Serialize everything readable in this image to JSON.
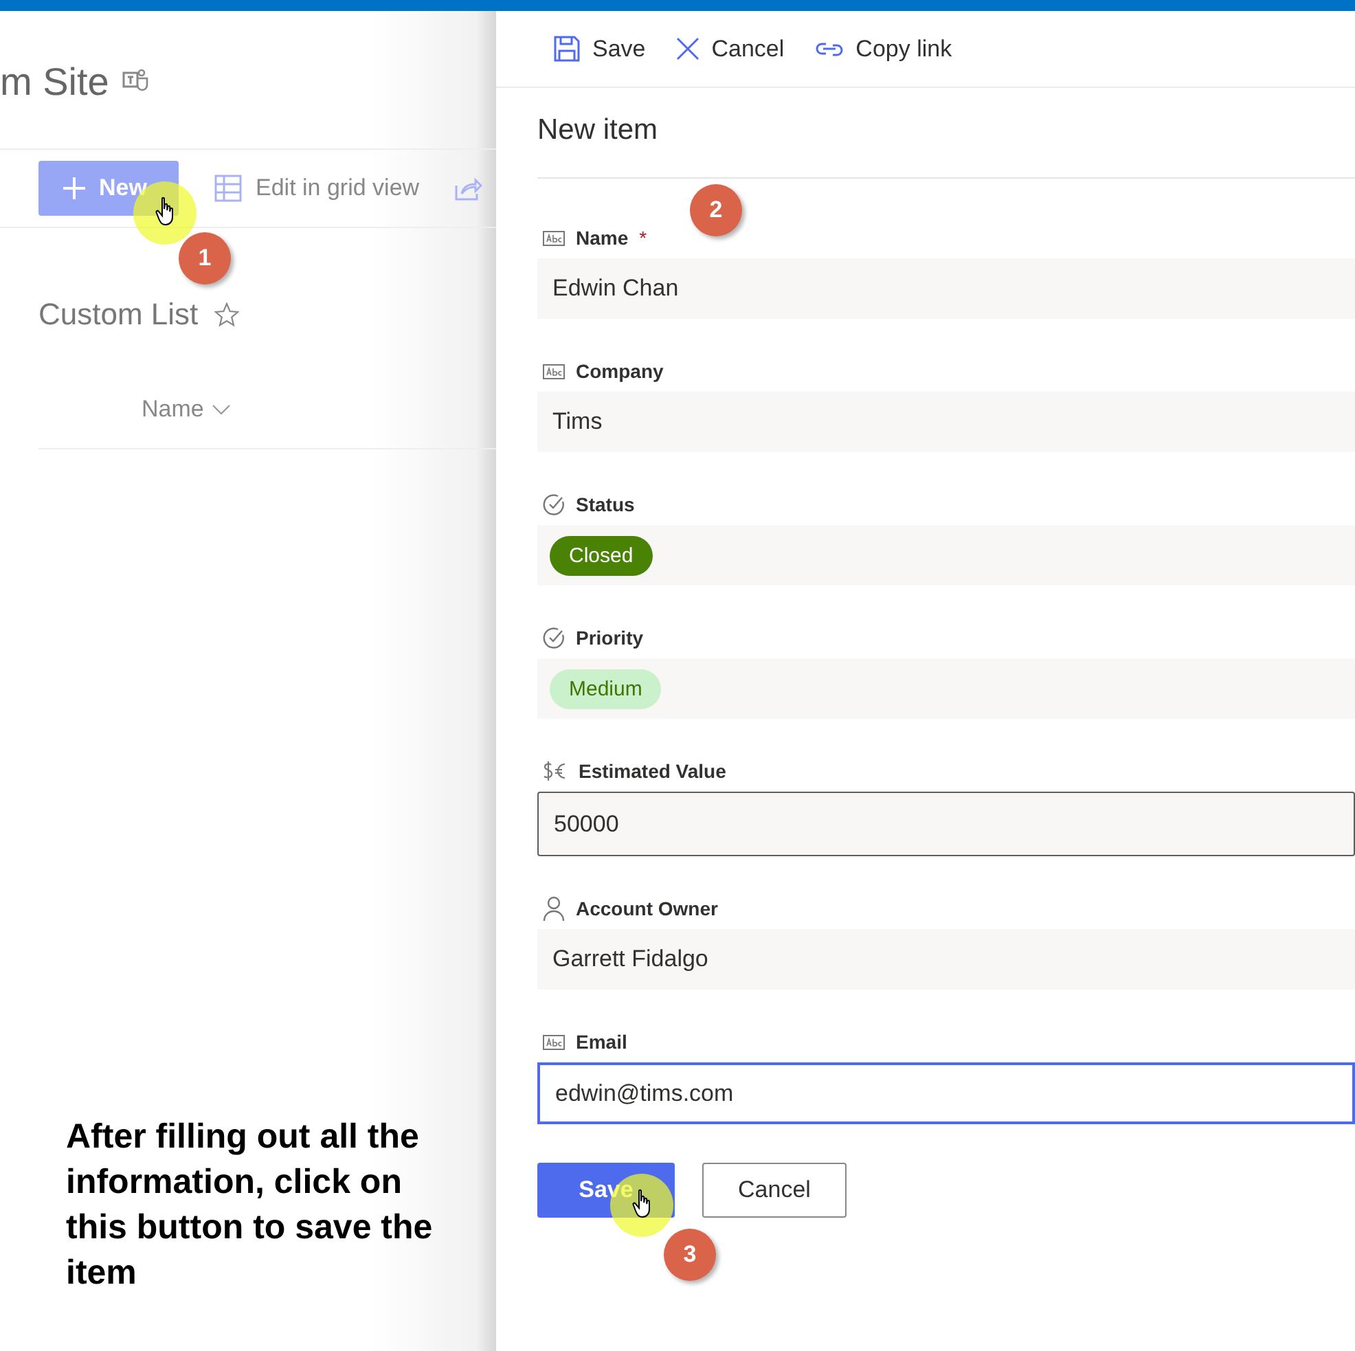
{
  "site": {
    "title": "m Site"
  },
  "toolbar": [
    {
      "kind": "new",
      "label": "New"
    },
    {
      "kind": "grid",
      "label": "Edit in grid view"
    },
    {
      "kind": "share"
    }
  ],
  "list": {
    "title": "Custom List",
    "favorite": false,
    "columns": [
      {
        "label": "Name"
      }
    ]
  },
  "note": "After filling out all the information, click on this button to save the item",
  "steps": [
    {
      "number": "1"
    },
    {
      "number": "2"
    },
    {
      "number": "3"
    }
  ],
  "panel": {
    "commands": [
      {
        "kind": "save",
        "label": "Save"
      },
      {
        "kind": "cancel",
        "label": "Cancel"
      },
      {
        "kind": "link",
        "label": "Copy link"
      }
    ],
    "title": "New item",
    "fields": [
      {
        "kind": "text",
        "label": "Name",
        "marker": "*",
        "value": "Edwin Chan",
        "focused": false
      },
      {
        "kind": "text",
        "label": "Company",
        "value": "Tims",
        "focused": false
      },
      {
        "kind": "choice",
        "label": "Status",
        "value": "Closed",
        "color": "#498205",
        "focused": false
      },
      {
        "kind": "choice",
        "label": "Priority",
        "value": "Medium",
        "color": "#caf0cc",
        "focused": false
      },
      {
        "kind": "currency",
        "label": "Estimated Value",
        "value": "50000",
        "focused": false
      },
      {
        "kind": "person",
        "label": "Account Owner",
        "value": "Garrett Fidalgo",
        "focused": false
      },
      {
        "kind": "text",
        "label": "Email",
        "value": "edwin@tims.com",
        "focused": true
      }
    ],
    "buttons": [
      {
        "kind": "primary",
        "label": "Save"
      },
      {
        "kind": "default",
        "label": "Cancel"
      }
    ]
  }
}
